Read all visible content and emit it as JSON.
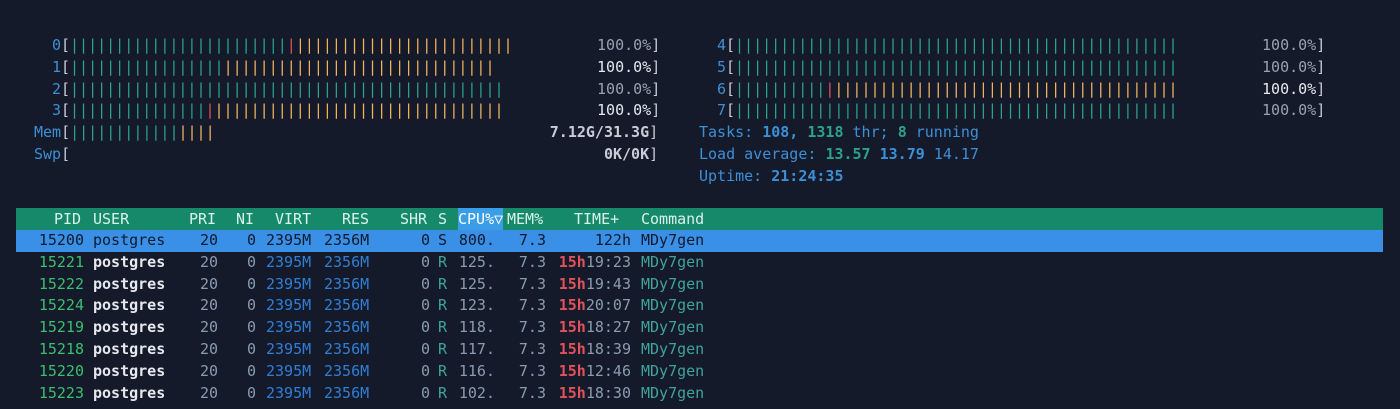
{
  "cpu_meters": [
    {
      "label": "0",
      "value": "100.0%",
      "green": 24,
      "orange": 24,
      "red": 1,
      "value_style": "dim"
    },
    {
      "label": "1",
      "value": "100.0%",
      "green": 17,
      "orange": 30,
      "red": 0,
      "value_style": "bright"
    },
    {
      "label": "2",
      "value": "100.0%",
      "green": 48,
      "orange": 0,
      "red": 0,
      "value_style": "dim"
    },
    {
      "label": "3",
      "value": "100.0%",
      "green": 15,
      "orange": 32,
      "red": 1,
      "value_style": "bright"
    },
    {
      "label": "4",
      "value": "100.0%",
      "green": 49,
      "orange": 0,
      "red": 0,
      "value_style": "dim"
    },
    {
      "label": "5",
      "value": "100.0%",
      "green": 49,
      "orange": 0,
      "red": 0,
      "value_style": "dim"
    },
    {
      "label": "6",
      "value": "100.0%",
      "green": 10,
      "orange": 38,
      "red": 1,
      "value_style": "bright"
    },
    {
      "label": "7",
      "value": "100.0%",
      "green": 49,
      "orange": 0,
      "red": 0,
      "value_style": "dim"
    }
  ],
  "mem": {
    "label": "Mem",
    "value": "7.12G/31.3G",
    "green": 12,
    "orange": 4
  },
  "swp": {
    "label": "Swp",
    "value": "0K/0K"
  },
  "tasks": {
    "label": "Tasks:",
    "count": "108,",
    "thr": "1318",
    "thr_label": "thr;",
    "running": "8",
    "running_label": "running"
  },
  "load": {
    "label": "Load average:",
    "l1": "13.57",
    "l5": "13.79",
    "l15": "14.17"
  },
  "uptime": {
    "label": "Uptime:",
    "value": "21:24:35"
  },
  "table": {
    "headers": {
      "pid": "PID",
      "user": "USER",
      "pri": "PRI",
      "ni": "NI",
      "virt": "VIRT",
      "res": "RES",
      "shr": "SHR",
      "s": "S",
      "cpu": "CPU%▽",
      "mem": "MEM%",
      "time": "TIME+",
      "cmd": "Command"
    },
    "rows": [
      {
        "pid": "15200",
        "user": "postgres",
        "pri": "20",
        "ni": "0",
        "virt": "2395M",
        "res": "2356M",
        "shr": "0",
        "s": "S",
        "cpu": "800.",
        "mem": "7.3",
        "time_h": "",
        "time": "122h",
        "cmd": "MDy7gen",
        "selected": true
      },
      {
        "pid": "15221",
        "user": "postgres",
        "pri": "20",
        "ni": "0",
        "virt": "2395M",
        "res": "2356M",
        "shr": "0",
        "s": "R",
        "cpu": "125.",
        "mem": "7.3",
        "time_h": "15h",
        "time": "19:23",
        "cmd": "MDy7gen"
      },
      {
        "pid": "15222",
        "user": "postgres",
        "pri": "20",
        "ni": "0",
        "virt": "2395M",
        "res": "2356M",
        "shr": "0",
        "s": "R",
        "cpu": "125.",
        "mem": "7.3",
        "time_h": "15h",
        "time": "19:43",
        "cmd": "MDy7gen"
      },
      {
        "pid": "15224",
        "user": "postgres",
        "pri": "20",
        "ni": "0",
        "virt": "2395M",
        "res": "2356M",
        "shr": "0",
        "s": "R",
        "cpu": "123.",
        "mem": "7.3",
        "time_h": "15h",
        "time": "20:07",
        "cmd": "MDy7gen"
      },
      {
        "pid": "15219",
        "user": "postgres",
        "pri": "20",
        "ni": "0",
        "virt": "2395M",
        "res": "2356M",
        "shr": "0",
        "s": "R",
        "cpu": "118.",
        "mem": "7.3",
        "time_h": "15h",
        "time": "18:27",
        "cmd": "MDy7gen"
      },
      {
        "pid": "15218",
        "user": "postgres",
        "pri": "20",
        "ni": "0",
        "virt": "2395M",
        "res": "2356M",
        "shr": "0",
        "s": "R",
        "cpu": "117.",
        "mem": "7.3",
        "time_h": "15h",
        "time": "18:39",
        "cmd": "MDy7gen"
      },
      {
        "pid": "15220",
        "user": "postgres",
        "pri": "20",
        "ni": "0",
        "virt": "2395M",
        "res": "2356M",
        "shr": "0",
        "s": "R",
        "cpu": "116.",
        "mem": "7.3",
        "time_h": "15h",
        "time": "12:46",
        "cmd": "MDy7gen"
      },
      {
        "pid": "15223",
        "user": "postgres",
        "pri": "20",
        "ni": "0",
        "virt": "2395M",
        "res": "2356M",
        "shr": "0",
        "s": "R",
        "cpu": "102.",
        "mem": "7.3",
        "time_h": "15h",
        "time": "18:30",
        "cmd": "MDy7gen"
      }
    ]
  },
  "colors": {
    "background": "#151a2a",
    "header_bar": "#17896b",
    "selected_row": "#3a90e6",
    "bar_green": "#2aa38a",
    "bar_orange": "#f0b35a",
    "bar_red": "#e0525a"
  }
}
